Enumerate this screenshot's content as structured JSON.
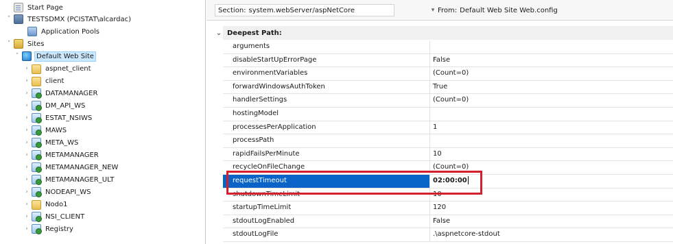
{
  "tree": {
    "items": [
      {
        "label": "Start Page",
        "icon": "start-page-icon",
        "expander": ""
      },
      {
        "label": "TESTSDMX (PCISTAT\\alcardac)",
        "icon": "server-icon",
        "expander": "v"
      },
      {
        "label": "Application Pools",
        "icon": "application-pools-icon",
        "expander": ""
      },
      {
        "label": "Sites",
        "icon": "sites-folder-icon",
        "expander": "v"
      },
      {
        "label": "Default Web Site",
        "icon": "globe-icon",
        "expander": "v"
      },
      {
        "label": "aspnet_client",
        "icon": "folder-icon",
        "expander": ">"
      },
      {
        "label": "client",
        "icon": "folder-icon",
        "expander": ">"
      },
      {
        "label": "DATAMANAGER",
        "icon": "web-application-icon",
        "expander": ">"
      },
      {
        "label": "DM_API_WS",
        "icon": "web-application-icon",
        "expander": ">"
      },
      {
        "label": "ESTAT_NSIWS",
        "icon": "web-application-icon",
        "expander": ">"
      },
      {
        "label": "MAWS",
        "icon": "web-application-icon",
        "expander": ">"
      },
      {
        "label": "META_WS",
        "icon": "web-application-icon",
        "expander": ">"
      },
      {
        "label": "METAMANAGER",
        "icon": "web-application-icon",
        "expander": ">"
      },
      {
        "label": "METAMANAGER_NEW",
        "icon": "web-application-icon",
        "expander": ">"
      },
      {
        "label": "METAMANAGER_ULT",
        "icon": "web-application-icon",
        "expander": ">"
      },
      {
        "label": "NODEAPI_WS",
        "icon": "web-application-icon",
        "expander": ">"
      },
      {
        "label": "Nodo1",
        "icon": "folder-icon",
        "expander": ">"
      },
      {
        "label": "NSI_CLIENT",
        "icon": "web-application-icon",
        "expander": ">"
      },
      {
        "label": "Registry",
        "icon": "web-application-icon",
        "expander": ">"
      }
    ]
  },
  "toolbar": {
    "section_label": "Section:",
    "section_value": "system.webServer/aspNetCore",
    "from_label": "From:",
    "from_value": "Default Web Site Web.config"
  },
  "properties": {
    "group_label": "Deepest Path:",
    "rows": [
      {
        "name": "arguments",
        "value": ""
      },
      {
        "name": "disableStartUpErrorPage",
        "value": "False"
      },
      {
        "name": "environmentVariables",
        "value": "(Count=0)"
      },
      {
        "name": "forwardWindowsAuthToken",
        "value": "True"
      },
      {
        "name": "handlerSettings",
        "value": "(Count=0)"
      },
      {
        "name": "hostingModel",
        "value": ""
      },
      {
        "name": "processesPerApplication",
        "value": "1"
      },
      {
        "name": "processPath",
        "value": ""
      },
      {
        "name": "rapidFailsPerMinute",
        "value": "10"
      },
      {
        "name": "recycleOnFileChange",
        "value": "(Count=0)"
      },
      {
        "name": "requestTimeout",
        "value": "02:00:00"
      },
      {
        "name": "shutdownTimeLimit",
        "value": "10"
      },
      {
        "name": "startupTimeLimit",
        "value": "120"
      },
      {
        "name": "stdoutLogEnabled",
        "value": "False"
      },
      {
        "name": "stdoutLogFile",
        "value": ".\\aspnetcore-stdout"
      }
    ],
    "selected_index": 10
  },
  "colors": {
    "selection_blue": "#0a64c8",
    "highlight_red": "#d51f2c",
    "tree_selection": "#cce8ff"
  }
}
